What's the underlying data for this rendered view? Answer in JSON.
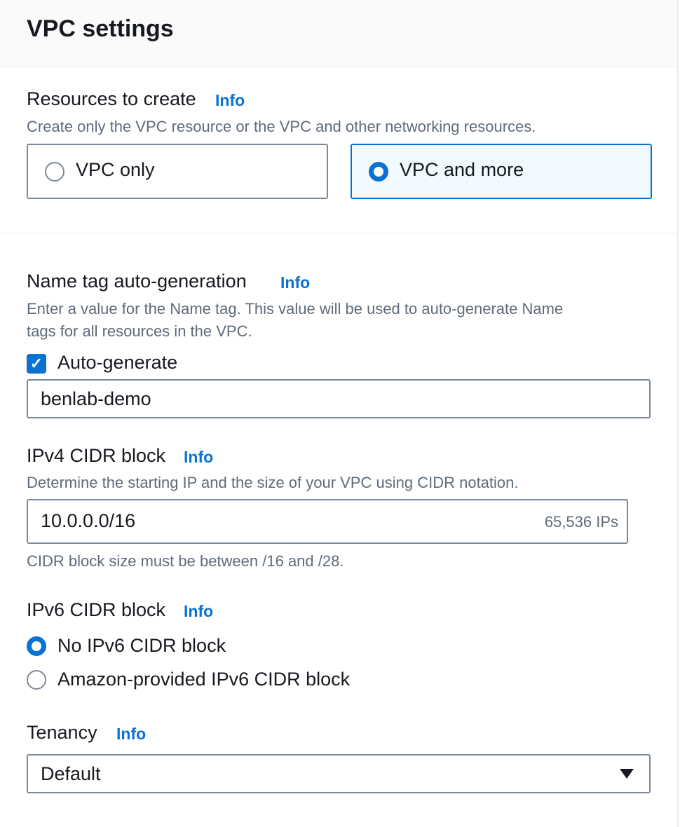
{
  "header": {
    "title": "VPC settings"
  },
  "resources": {
    "label": "Resources to create",
    "info": "Info",
    "description": "Create only the VPC resource or the VPC and other networking resources.",
    "options": [
      {
        "label": "VPC only",
        "selected": false
      },
      {
        "label": "VPC and more",
        "selected": true
      }
    ]
  },
  "name_tag": {
    "label": "Name tag auto-generation",
    "info": "Info",
    "description_line1": "Enter a value for the Name tag. This value will be used to auto-generate Name",
    "description_line2": "tags for all resources in the VPC.",
    "checkbox_label": "Auto-generate",
    "checkbox_checked": true,
    "value": "benlab-demo"
  },
  "ipv4": {
    "label": "IPv4 CIDR block",
    "info": "Info",
    "description": "Determine the starting IP and the size of your VPC using CIDR notation.",
    "value": "10.0.0.0/16",
    "suffix": "65,536 IPs",
    "constraint": "CIDR block size must be between /16 and /28."
  },
  "ipv6": {
    "label": "IPv6 CIDR block",
    "info": "Info",
    "options": [
      {
        "label": "No IPv6 CIDR block",
        "selected": true
      },
      {
        "label": "Amazon-provided IPv6 CIDR block",
        "selected": false
      }
    ]
  },
  "tenancy": {
    "label": "Tenancy",
    "info": "Info",
    "value": "Default"
  },
  "colors": {
    "accent": "#0972d3",
    "border": "#7d8998",
    "text": "#16191f",
    "muted": "#5f6b7a"
  }
}
